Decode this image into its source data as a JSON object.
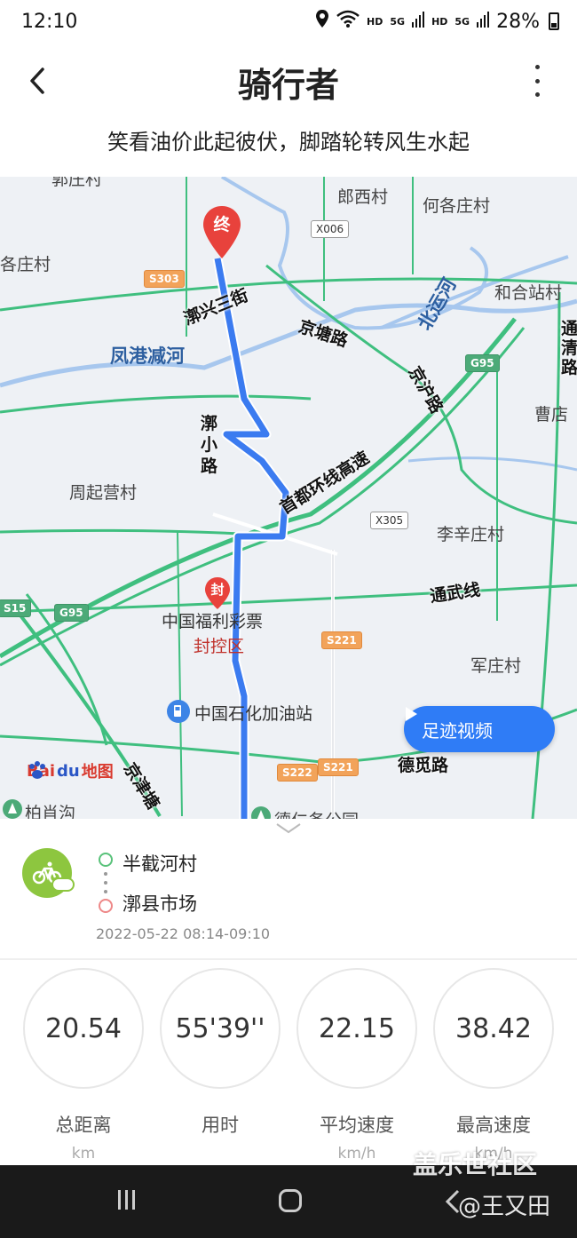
{
  "status_bar": {
    "time": "12:10",
    "network_a": "HD",
    "signal_a": "5G",
    "network_b": "HD",
    "signal_b": "5G",
    "battery": "28%"
  },
  "app_bar": {
    "title": "骑行者"
  },
  "slogan": "笑看油价此起彼伏，脚踏轮转风生水起",
  "map": {
    "labels": {
      "village_top": "郭庄村",
      "langxi": "郎西村",
      "hege": "何各庄村",
      "gezhuang": "各庄村",
      "hehe": "和合站村",
      "xingsanjie": "漷兴三街",
      "jingtang": "京塘路",
      "beiyun": "北运河",
      "tongqing": "通清路",
      "fenggang": "凤港减河",
      "jinghu": "京沪路",
      "caodian": "曹店",
      "xiaolu": "漷小路",
      "zhouqi": "周起营村",
      "shoudu": "首都环线高速",
      "lixin": "李辛庄村",
      "tongwu": "通武线",
      "lottery": "中国福利彩票",
      "blocked": "封控区",
      "junzhuang": "军庄村",
      "sinopec": "中国石化加油站",
      "demi": "德觅路",
      "jinglu": "京津塘",
      "baixiao": "柏肖沟",
      "dexing": "德仁务公园"
    },
    "shields": {
      "x006": "X006",
      "s303": "S303",
      "g95a": "G95",
      "x305": "X305",
      "s15": "S15",
      "g95b": "G95",
      "s221a": "S221",
      "s222": "S222",
      "s221b": "S221"
    },
    "end_marker": "终",
    "blocked_marker": "封",
    "footprint_button": "足迹视频",
    "logo_bai": "Bai",
    "logo_du": "du",
    "logo_map": "地图",
    "route_color": "#3b7bf0"
  },
  "route": {
    "start": "半截河村",
    "end": "漷县市场",
    "time": "2022-05-22  08:14-09:10",
    "badge_color": "#8dc63f"
  },
  "stats": [
    {
      "value": "20.54",
      "label": "总距离",
      "unit": "km"
    },
    {
      "value": "55'39''",
      "label": "用时",
      "unit": ""
    },
    {
      "value": "22.15",
      "label": "平均速度",
      "unit": "km/h"
    },
    {
      "value": "38.42",
      "label": "最高速度",
      "unit": "km/h"
    }
  ],
  "watermark": {
    "line1": "盖乐世社区",
    "line2": "@王又田"
  }
}
